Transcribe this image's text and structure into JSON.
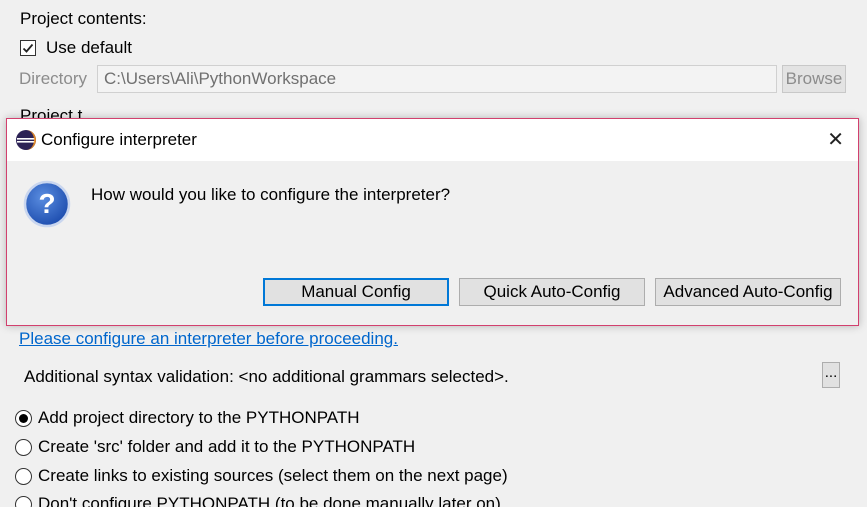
{
  "project_contents": {
    "heading": "Project contents:",
    "use_default_label": "Use default",
    "use_default_checked": true,
    "directory_label": "Directory",
    "directory_value": "C:\\Users\\Ali\\PythonWorkspace",
    "browse_label": "Browse",
    "partial_heading": "Project t..."
  },
  "dialog": {
    "title": "Configure interpreter",
    "question": "How would you like to configure the interpreter?",
    "buttons": {
      "manual": "Manual Config",
      "quick": "Quick Auto-Config",
      "advanced": "Advanced Auto-Config"
    },
    "icons": {
      "app": "eclipse-icon",
      "close": "close-icon",
      "question": "question-icon"
    },
    "accent_border": "#d2406e"
  },
  "interpreter_link": "Please configure an interpreter before proceeding.",
  "syntax_validation": {
    "label": "Additional syntax validation: <no additional grammars selected>.",
    "button": "..."
  },
  "pythonpath_options": [
    {
      "label": "Add project directory to the PYTHONPATH",
      "selected": true
    },
    {
      "label": "Create 'src' folder and add it to the PYTHONPATH",
      "selected": false
    },
    {
      "label": "Create links to existing sources (select them on the next page)",
      "selected": false
    },
    {
      "label": "Don't configure PYTHONPATH (to be done manually later on)",
      "selected": false
    }
  ]
}
